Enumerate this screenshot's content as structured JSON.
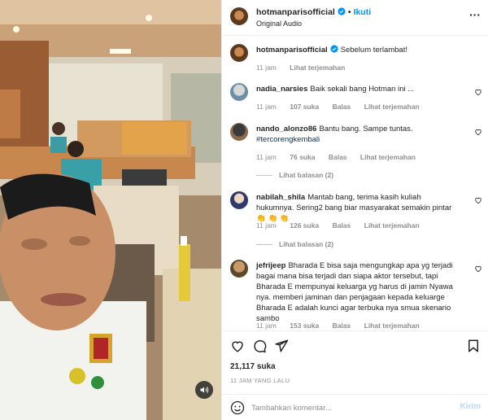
{
  "post": {
    "username": "hotmanparisofficial",
    "follow_label": "Ikuti",
    "audio_label": "Original Audio",
    "more_icon": "more-horizontal-icon",
    "caption": {
      "username": "hotmanparisofficial",
      "text": "Sebelum terlambat!",
      "time": "11 jam",
      "translate_label": "Lihat terjemahan"
    },
    "likes": "21,117 suka",
    "time_ago": "11 JAM YANG LALU"
  },
  "comments": [
    {
      "username": "nadia_narsies",
      "text": "Baik sekali bang Hotman ini ...",
      "tag": "",
      "time": "11 jam",
      "likes": "107 suka",
      "reply_label": "Balas",
      "translate_label": "Lihat terjemahan",
      "view_replies": ""
    },
    {
      "username": "nando_alonzo86",
      "text": "Bantu bang. Sampe tuntas.",
      "tag": "#tercorengkembali",
      "time": "11 jam",
      "likes": "76 suka",
      "reply_label": "Balas",
      "translate_label": "Lihat terjemahan",
      "view_replies": "Lihat balasan (2)"
    },
    {
      "username": "nabilah_shila",
      "text": "Mantab bang, terima kasih kuliah hukumnya. Sering2 bang biar masyarakat semakin pintar 👏 👏 👏",
      "tag": "",
      "time": "11 jam",
      "likes": "126 suka",
      "reply_label": "Balas",
      "translate_label": "Lihat terjemahan",
      "view_replies": "Lihat balasan (2)"
    },
    {
      "username": "jefrijeep",
      "text": "Bharada E bisa saja mengungkap apa yg terjadi bagai mana bisa terjadi dan siapa aktor tersebut, tapi Bharada E mempunyai keluarga yg harus di jamin Nyawa nya. memberi jaminan dan penjagaan kepada keluarge Bharada E adalah kunci agar terbuka nya smua skenario sambo",
      "tag": "",
      "time": "11 jam",
      "likes": "153 suka",
      "reply_label": "Balas",
      "translate_label": "Lihat terjemahan",
      "view_replies": ""
    }
  ],
  "composer": {
    "placeholder": "Tambahkan komentar...",
    "post_label": "Kirim"
  },
  "colors": {
    "link_blue": "#0095f6",
    "post_disabled": "#b3dbff",
    "secondary_text": "#8e8e8e"
  }
}
